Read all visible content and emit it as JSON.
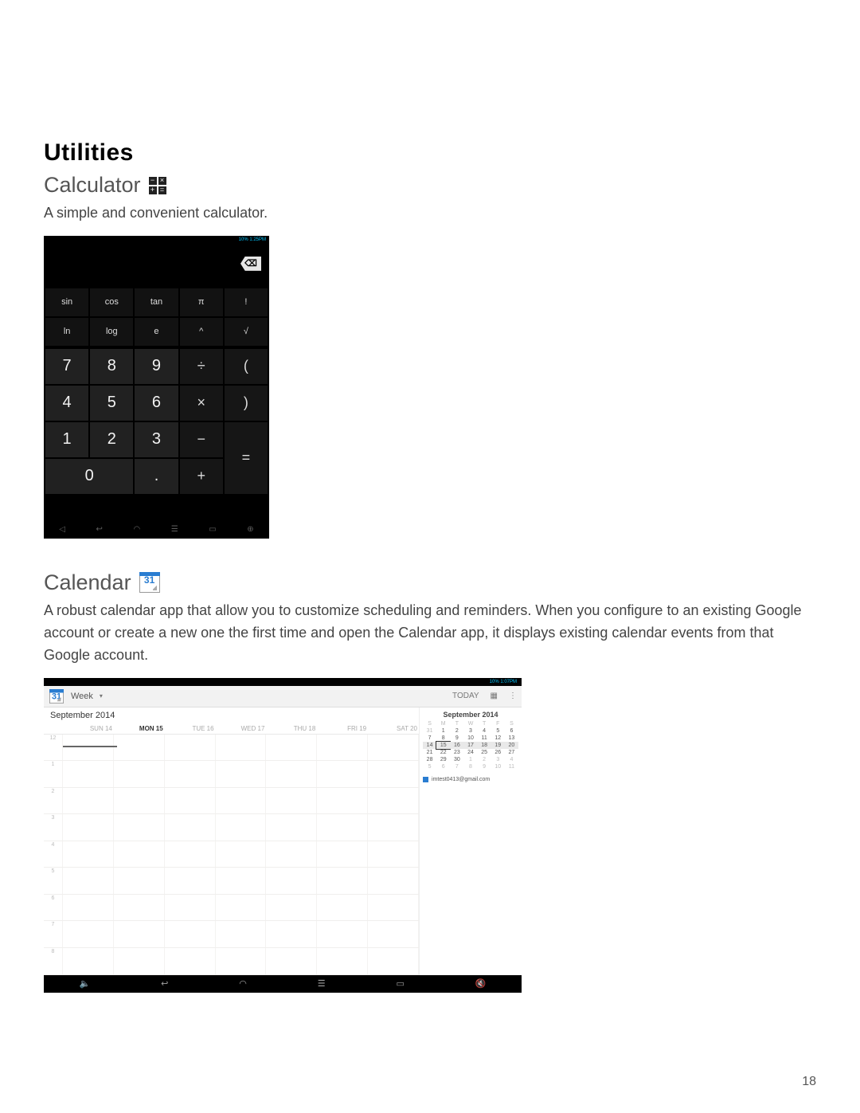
{
  "page_number": "18",
  "headings": {
    "utilities": "Utilities",
    "calculator": "Calculator",
    "calendar": "Calendar"
  },
  "text": {
    "calculator_desc": "A simple and convenient calculator.",
    "calendar_desc": "A robust calendar app that allow you to customize scheduling and reminders. When you configure to an existing Google account or create a new one the first time and open the Calendar app, it displays existing calendar events from that Google account."
  },
  "calc_icon_cells": [
    "−",
    "×",
    "+",
    "="
  ],
  "calendar_icon_day": "31",
  "calculator_screenshot": {
    "status_time": "10% 1:25PM",
    "delete_label": "⌫",
    "sci_row1": [
      "sin",
      "cos",
      "tan",
      "π",
      "!"
    ],
    "sci_row2": [
      "ln",
      "log",
      "e",
      "^",
      "√"
    ],
    "num_rows": [
      [
        "7",
        "8",
        "9",
        "÷",
        "("
      ],
      [
        "4",
        "5",
        "6",
        "×",
        ")"
      ],
      [
        "1",
        "2",
        "3",
        "−",
        ""
      ],
      [
        "0",
        "",
        ".",
        "+",
        "="
      ]
    ],
    "nav_icons": [
      "◁",
      "↩",
      "◠",
      "☰",
      "▭",
      "⊕"
    ]
  },
  "calendar_screenshot": {
    "status_time": "10% 1:07PM",
    "toolbar": {
      "view_label": "Week",
      "today_label": "TODAY",
      "icons": [
        "calendar-small",
        "today",
        "new-event",
        "overflow"
      ]
    },
    "month_label": "September 2014",
    "day_headers": [
      "",
      "SUN 14",
      "MON 15",
      "TUE 16",
      "WED 17",
      "THU 18",
      "FRI 19",
      "SAT 20"
    ],
    "first_hour_label": "12\nPM",
    "hour_labels": [
      "12",
      "1",
      "2",
      "3",
      "4",
      "5",
      "6",
      "7",
      "8"
    ],
    "mini_month": {
      "title": "September 2014",
      "dow": [
        "S",
        "M",
        "T",
        "W",
        "T",
        "F",
        "S"
      ],
      "rows": [
        [
          "31",
          "1",
          "2",
          "3",
          "4",
          "5",
          "6"
        ],
        [
          "7",
          "8",
          "9",
          "10",
          "11",
          "12",
          "13"
        ],
        [
          "14",
          "15",
          "16",
          "17",
          "18",
          "19",
          "20"
        ],
        [
          "21",
          "22",
          "23",
          "24",
          "25",
          "26",
          "27"
        ],
        [
          "28",
          "29",
          "30",
          "1",
          "2",
          "3",
          "4"
        ],
        [
          "5",
          "6",
          "7",
          "8",
          "9",
          "10",
          "11"
        ]
      ],
      "selected": "15",
      "highlight_row_index": 2
    },
    "account_email": "imtest0413@gmail.com",
    "nav_icons": [
      "🔈",
      "↩",
      "◠",
      "☰",
      "▭",
      "🔇"
    ]
  }
}
